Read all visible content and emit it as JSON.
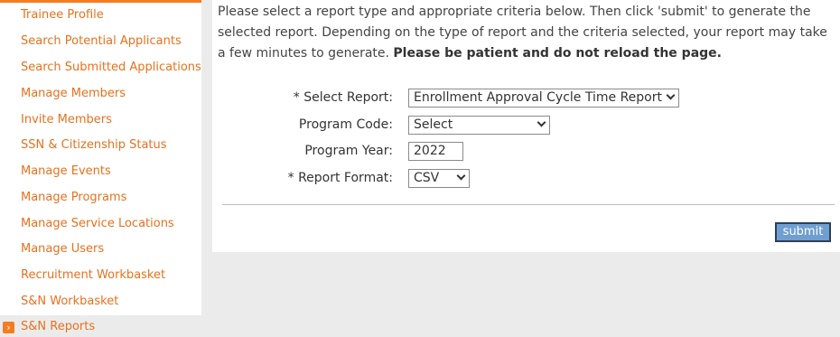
{
  "sidebar": {
    "items": [
      {
        "label": "Trainee Profile"
      },
      {
        "label": "Search Potential Applicants"
      },
      {
        "label": "Search Submitted Applications"
      },
      {
        "label": "Manage Members"
      },
      {
        "label": "Invite Members"
      },
      {
        "label": "SSN & Citizenship Status"
      },
      {
        "label": "Manage Events"
      },
      {
        "label": "Manage Programs"
      },
      {
        "label": "Manage Service Locations"
      },
      {
        "label": "Manage Users"
      },
      {
        "label": "Recruitment Workbasket"
      },
      {
        "label": "S&N Workbasket"
      },
      {
        "label": "S&N Reports",
        "active": true
      }
    ]
  },
  "intro": {
    "text": "Please select a report type and appropriate criteria below. Then click 'submit' to generate the selected report. Depending on the type of report and the criteria selected, your report may take a few minutes to generate. ",
    "bold": "Please be patient and do not reload the page."
  },
  "form": {
    "report_label": "*  Select Report:",
    "report_value": "Enrollment Approval Cycle Time Report",
    "program_code_label": "Program Code:",
    "program_code_value": "Select",
    "program_year_label": "Program Year:",
    "program_year_value": "2022",
    "format_label": "* Report Format:",
    "format_value": "CSV"
  },
  "actions": {
    "submit_label": "submit"
  }
}
